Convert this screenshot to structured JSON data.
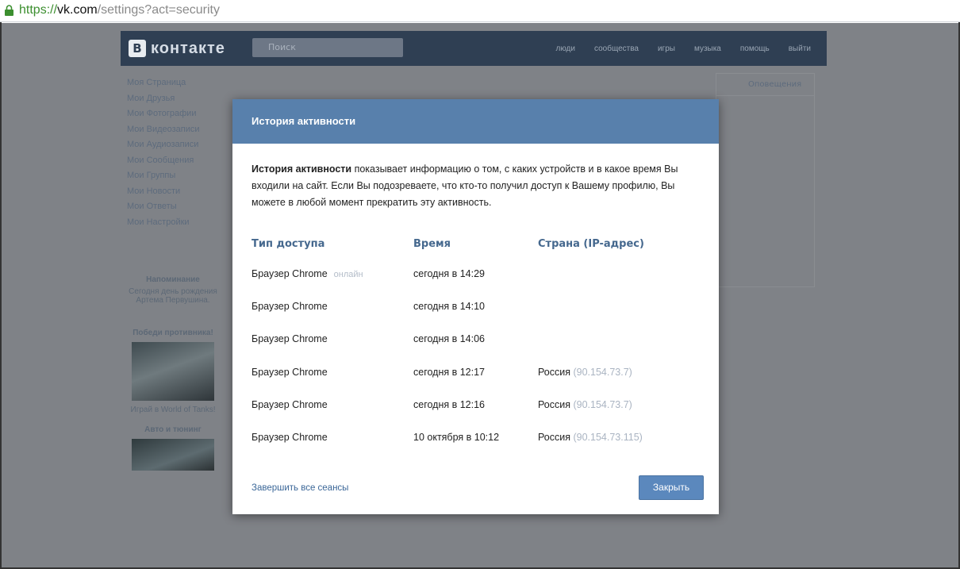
{
  "browser": {
    "url_scheme": "https://",
    "url_host": "vk.com",
    "url_path": "/settings?act=security"
  },
  "modal": {
    "title": "История активности",
    "intro_bold": "История активности",
    "intro_text": " показывает информацию о том, с каких устройств и в какое время Вы входили на сайт. Если Вы подозреваете, что кто-то получил доступ к Вашему профилю, Вы можете в любой момент прекратить эту активность.",
    "columns": [
      "Тип доступа",
      "Время",
      "Страна (IP-адрес)"
    ],
    "rows": [
      {
        "access": "Браузер Chrome",
        "badge": "онлайн",
        "time": "сегодня в 14:29",
        "country": "",
        "ip": ""
      },
      {
        "access": "Браузер Chrome",
        "badge": "",
        "time": "сегодня в 14:10",
        "country": "",
        "ip": ""
      },
      {
        "access": "Браузер Chrome",
        "badge": "",
        "time": "сегодня в 14:06",
        "country": "",
        "ip": ""
      },
      {
        "access": "Браузер Chrome",
        "badge": "",
        "time": "сегодня в 12:17",
        "country": "Россия",
        "ip": "(90.154.73.7)"
      },
      {
        "access": "Браузер Chrome",
        "badge": "",
        "time": "сегодня в 12:16",
        "country": "Россия",
        "ip": "(90.154.73.7)"
      },
      {
        "access": "Браузер Chrome",
        "badge": "",
        "time": "10 октября в 10:12",
        "country": "Россия",
        "ip": "(90.154.73.115)"
      }
    ],
    "end_all_link": "Завершить все сеансы",
    "close_button": "Закрыть"
  },
  "background": {
    "logo_text": "контакте",
    "search_placeholder": "Поиск",
    "nav": [
      "люди",
      "сообщества",
      "игры",
      "музыка",
      "помощь",
      "выйти"
    ],
    "menu": [
      "Моя Страница",
      "Мои Друзья",
      "Мои Фотографии",
      "Мои Видеозаписи",
      "Мои Аудиозаписи",
      "Мои Сообщения",
      "Мои Группы",
      "Мои Новости",
      "Мои Ответы",
      "Мои Настройки"
    ],
    "promo_title": "Напоминание",
    "promo_text": "Сегодня день рождения Артема Первушина.",
    "ad1_title": "Победи противника!",
    "ad1_caption": "Играй в World of Tanks!",
    "ad2_title": "Авто и тюнинг",
    "right_tab": "Оповещения"
  },
  "colors": {
    "header_blue": "#5880ac",
    "button_blue": "#5b88bd",
    "column_header": "#45688e",
    "link": "#3b6798",
    "overlay_gray": "#7f8287",
    "vk_header": "#2f3f53"
  }
}
